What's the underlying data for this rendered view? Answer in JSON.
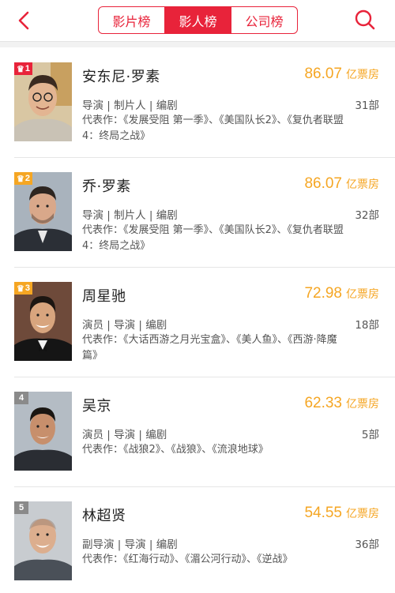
{
  "header": {
    "tabs": [
      {
        "label": "影片榜",
        "active": false
      },
      {
        "label": "影人榜",
        "active": true
      },
      {
        "label": "公司榜",
        "active": false
      }
    ],
    "accent_color": "#e8233a",
    "back_icon": "chevron-left-icon",
    "search_icon": "search-icon"
  },
  "list": [
    {
      "rank": "1",
      "name": "安东尼·罗素",
      "box_office": "86.07",
      "unit": "亿票房",
      "roles": "导演 | 制片人 | 编剧",
      "count": "31部",
      "works": "代表作：《发展受阻 第一季》、《美国队长2》、《复仇者联盟4：终局之战》"
    },
    {
      "rank": "2",
      "name": "乔·罗素",
      "box_office": "86.07",
      "unit": "亿票房",
      "roles": "导演 | 制片人 | 编剧",
      "count": "32部",
      "works": "代表作：《发展受阻 第一季》、《美国队长2》、《复仇者联盟4：终局之战》"
    },
    {
      "rank": "3",
      "name": "周星驰",
      "box_office": "72.98",
      "unit": "亿票房",
      "roles": "演员 | 导演 | 编剧",
      "count": "18部",
      "works": "代表作：《大话西游之月光宝盒》、《美人鱼》、《西游·降魔篇》"
    },
    {
      "rank": "4",
      "name": "吴京",
      "box_office": "62.33",
      "unit": "亿票房",
      "roles": "演员 | 导演 | 编剧",
      "count": "5部",
      "works": "代表作：《战狼2》、《战狼》、《流浪地球》"
    },
    {
      "rank": "5",
      "name": "林超贤",
      "box_office": "54.55",
      "unit": "亿票房",
      "roles": "副导演 | 导演 | 编剧",
      "count": "36部",
      "works": "代表作：《红海行动》、《湄公河行动》、《逆战》"
    }
  ],
  "colors": {
    "box_office": "#f5a623",
    "rank_top": "#e8233a",
    "rank_gold": "#f5a623",
    "rank_plain": "#8a8a8a"
  }
}
